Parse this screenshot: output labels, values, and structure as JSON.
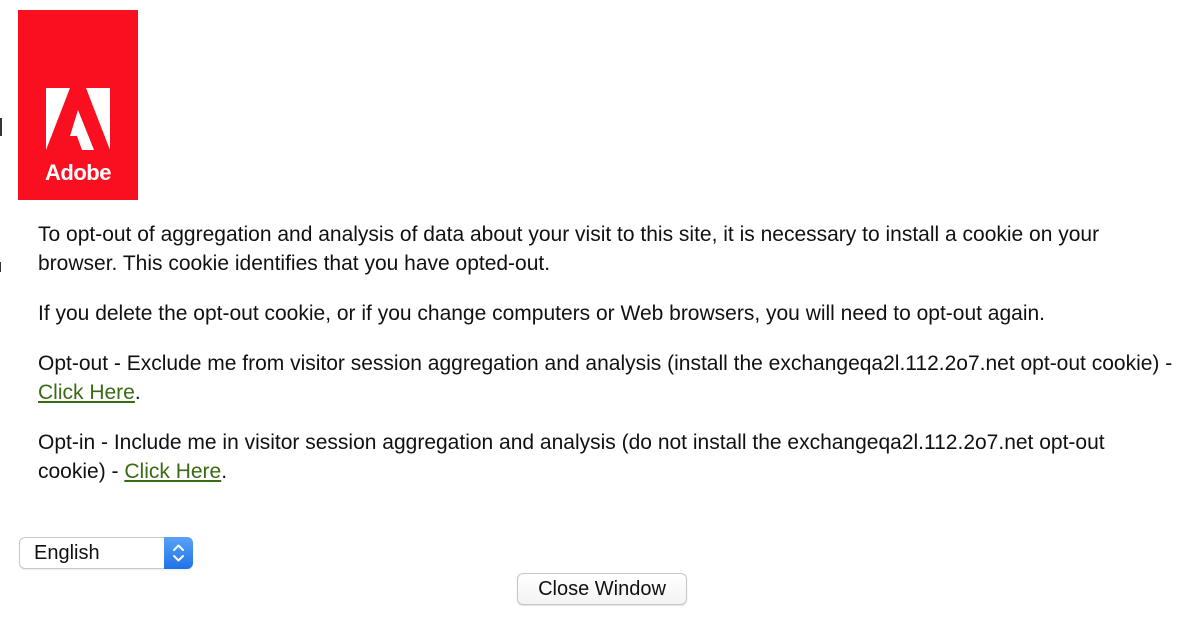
{
  "logo": {
    "text": "Adobe",
    "color": "#fa0f20"
  },
  "paragraphs": {
    "intro": "To opt-out of aggregation and analysis of data about your visit to this site, it is necessary to install a cookie on your browser. This cookie identifies that you have opted-out.",
    "delete_note": "If you delete the opt-out cookie, or if you change computers or Web browsers, you will need to opt-out again.",
    "optout_text": "Opt-out - Exclude me from visitor session aggregation and analysis (install the exchangeqa2l.112.2o7.net opt-out cookie) - ",
    "optout_link": "Click Here",
    "optin_text": "Opt-in - Include me in visitor session aggregation and analysis (do not install the exchangeqa2l.112.2o7.net opt-out cookie) - ",
    "optin_link": "Click Here",
    "period": "."
  },
  "language_select": {
    "selected": "English",
    "icon": "updown-chevron-icon"
  },
  "buttons": {
    "close_label": "Close Window"
  },
  "colors": {
    "link": "#3a6a14",
    "select_stepper": "#2a7ef0"
  }
}
